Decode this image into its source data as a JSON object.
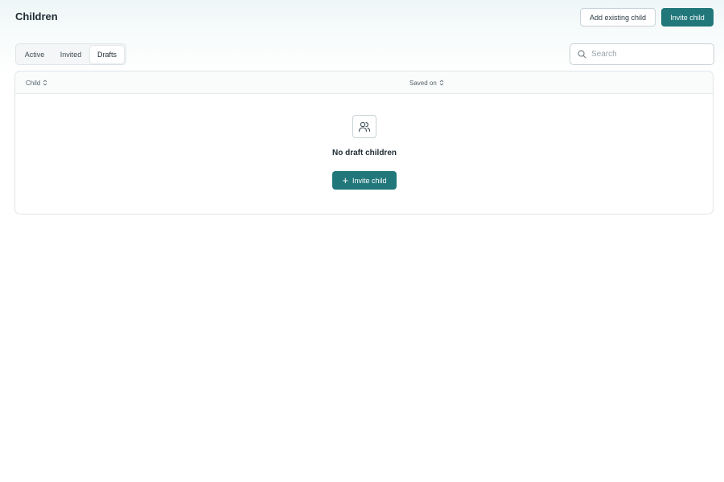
{
  "header": {
    "title": "Children",
    "add_existing_label": "Add existing child",
    "invite_label": "Invite child"
  },
  "tabs": [
    {
      "label": "Active",
      "active": false
    },
    {
      "label": "Invited",
      "active": false
    },
    {
      "label": "Drafts",
      "active": true
    }
  ],
  "search": {
    "placeholder": "Search",
    "value": ""
  },
  "table": {
    "columns": [
      "Child",
      "Saved on"
    ],
    "rows": []
  },
  "empty_state": {
    "icon": "users-icon",
    "title": "No draft children",
    "button_icon": "plus-icon",
    "button_label": "Invite child"
  },
  "colors": {
    "primary": "#21777a",
    "border": "#c9d2d6",
    "text": "#1e2b33"
  }
}
